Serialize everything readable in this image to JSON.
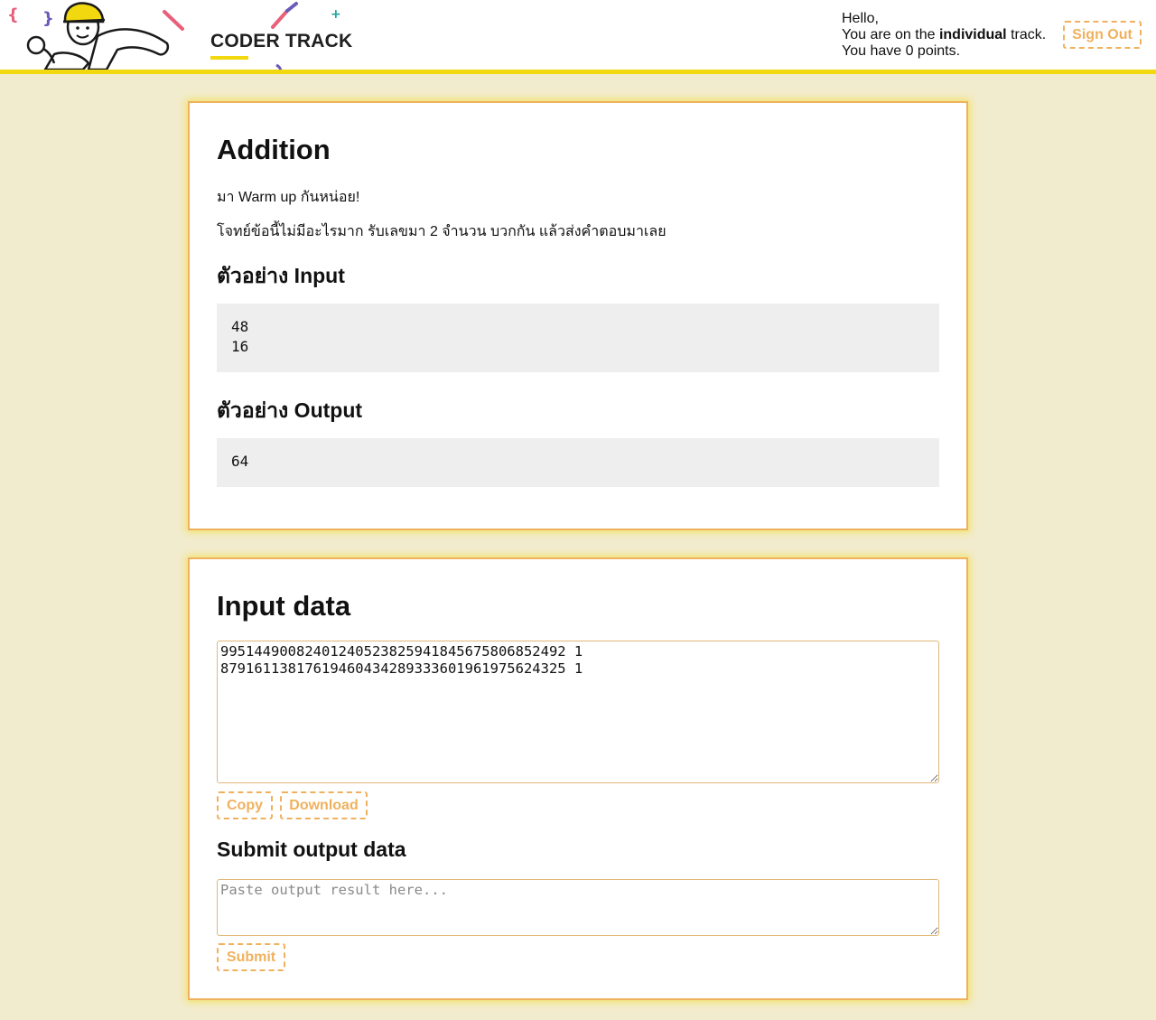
{
  "header": {
    "brand": "CODER TRACK",
    "greeting_hello": "Hello,",
    "greeting_track_prefix": "You are on the",
    "greeting_track_name": "individual",
    "greeting_track_suffix": "track.",
    "greeting_points": "You have 0 points.",
    "sign_out_label": "Sign Out"
  },
  "problem": {
    "title": "Addition",
    "intro": "มา Warm up กันหน่อย!",
    "description": "โจทย์ข้อนี้ไม่มีอะไรมาก รับเลขมา 2 จำนวน บวกกัน แล้วส่งคำตอบมาเลย",
    "sample_input_heading": "ตัวอย่าง Input",
    "sample_input": "48\n16",
    "sample_output_heading": "ตัวอย่าง Output",
    "sample_output": "64"
  },
  "submission": {
    "title": "Input data",
    "input_data": "99514490082401240523825941845675806852492 1\n87916113817619460434289333601961975624325 1",
    "copy_label": "Copy",
    "download_label": "Download",
    "submit_heading": "Submit output data",
    "output_placeholder": "Paste output result here...",
    "submit_label": "Submit"
  },
  "colors": {
    "accent_yellow": "#f2d80e",
    "accent_orange": "#f0b15e",
    "page_background": "#f2ecce",
    "sample_background": "#eeeeee"
  }
}
